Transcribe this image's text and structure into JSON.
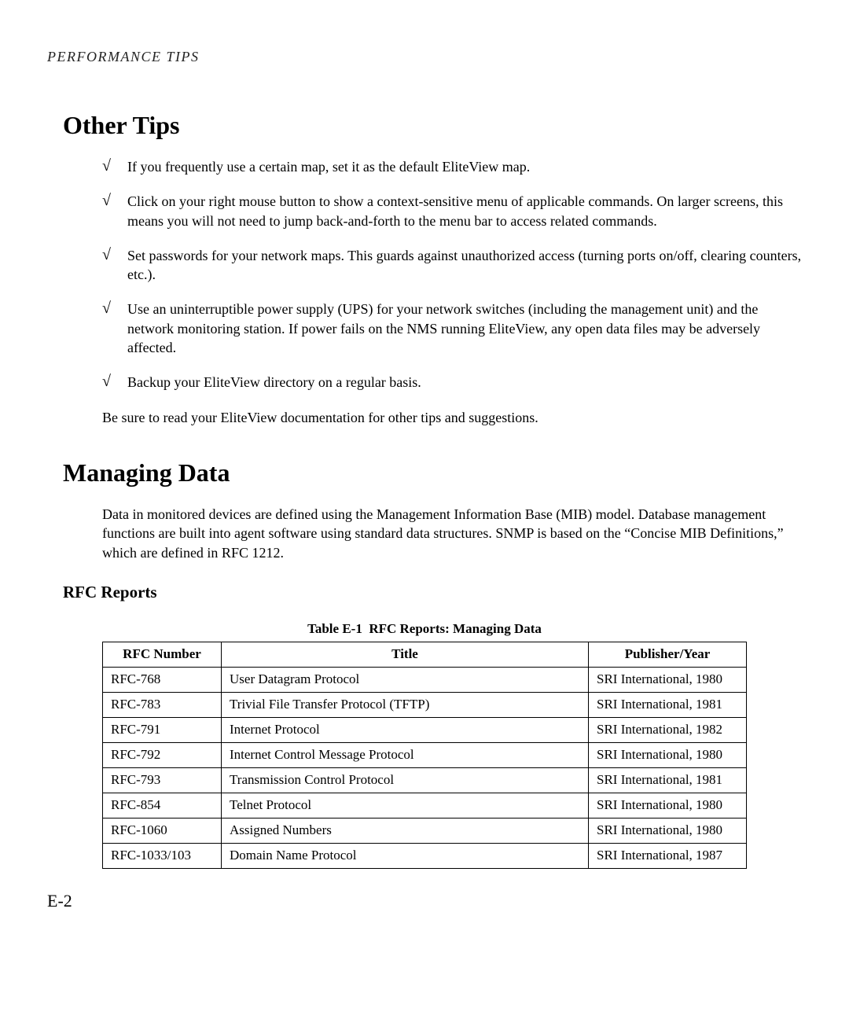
{
  "running_head": "PERFORMANCE TIPS",
  "section_other_tips": {
    "title": "Other Tips",
    "tips": [
      "If you frequently use a certain map, set it as the default EliteView map.",
      "Click on your right mouse button to show a context-sensitive menu of applicable commands. On larger screens, this means you will not need to jump back-and-forth to the menu bar to access related commands.",
      "Set passwords for your network maps. This guards against unauthorized access (turning ports on/off, clearing counters, etc.).",
      "Use an uninterruptible power supply (UPS) for your network switches (including the management unit) and the network monitoring station. If power fails on the NMS running EliteView, any open data files may be adversely affected.",
      "Backup your EliteView directory on a regular basis."
    ],
    "footer": "Be sure to read your EliteView documentation for other tips and suggestions."
  },
  "section_managing_data": {
    "title": "Managing Data",
    "body": "Data in monitored devices are defined using the Management Information Base (MIB) model. Database management functions are built into agent software using standard data structures. SNMP is based on the “Concise MIB Definitions,” which are defined in RFC 1212.",
    "subheading": "RFC Reports",
    "table": {
      "caption_label": "Table E-1",
      "caption_title": "RFC Reports: Managing Data",
      "headers": [
        "RFC Number",
        "Title",
        "Publisher/Year"
      ],
      "rows": [
        [
          "RFC-768",
          "User Datagram Protocol",
          "SRI International, 1980"
        ],
        [
          "RFC-783",
          "Trivial File Transfer Protocol (TFTP)",
          "SRI International, 1981"
        ],
        [
          "RFC-791",
          "Internet Protocol",
          "SRI International, 1982"
        ],
        [
          "RFC-792",
          "Internet Control Message Protocol",
          "SRI International, 1980"
        ],
        [
          "RFC-793",
          "Transmission Control Protocol",
          "SRI International, 1981"
        ],
        [
          "RFC-854",
          "Telnet Protocol",
          "SRI International, 1980"
        ],
        [
          "RFC-1060",
          "Assigned Numbers",
          "SRI International, 1980"
        ],
        [
          "RFC-1033/103",
          "Domain Name Protocol",
          "SRI International, 1987"
        ]
      ]
    }
  },
  "page_number": "E-2",
  "check_glyph": "√"
}
